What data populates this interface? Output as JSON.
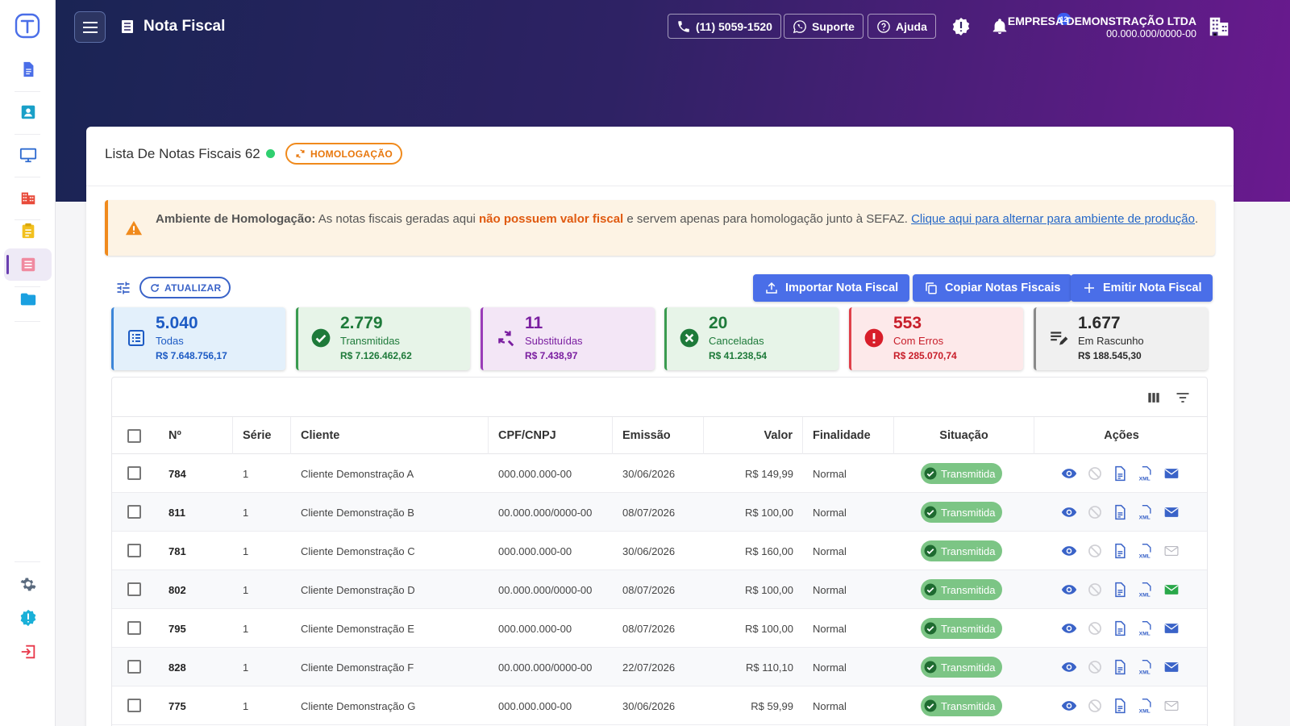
{
  "header": {
    "title": "Nota Fiscal",
    "phone": "(11) 5059-1520",
    "support": "Suporte",
    "help": "Ajuda",
    "notifications": "12",
    "company_name": "EMPRESA DEMONSTRAÇÃO LTDA",
    "company_cnpj": "00.000.000/0000-00"
  },
  "card": {
    "title": "Lista De Notas Fiscais 62",
    "env_badge": "HOMOLOGAÇÃO"
  },
  "alert": {
    "label": "Ambiente de Homologação:",
    "text1": " As notas fiscais geradas aqui ",
    "emph": "não possuem valor fiscal",
    "text2": " e servem apenas para homologação junto à SEFAZ. ",
    "link": "Clique aqui para alternar para ambiente de produção",
    "end": "."
  },
  "toolbar": {
    "refresh": "ATUALIZAR",
    "import": "Importar Nota Fiscal",
    "copy": "Copiar Notas Fiscais",
    "emit": "Emitir Nota Fiscal"
  },
  "stats": [
    {
      "num": "5.040",
      "label": "Todas",
      "value": "R$ 7.648.756,17",
      "color": "#1d5bc4",
      "bg": "#e3f0fb",
      "border": "#3d86d8"
    },
    {
      "num": "2.779",
      "label": "Transmitidas",
      "value": "R$ 7.126.462,62",
      "color": "#1e7a3a",
      "bg": "#e7f4e8",
      "border": "#3a9b50"
    },
    {
      "num": "11",
      "label": "Substituídas",
      "value": "R$ 7.438,97",
      "color": "#7a1ea0",
      "bg": "#f3e6f6",
      "border": "#9a3cb8"
    },
    {
      "num": "20",
      "label": "Canceladas",
      "value": "R$ 41.238,54",
      "color": "#1e7a3a",
      "bg": "#e7f4e8",
      "border": "#3a9b50"
    },
    {
      "num": "553",
      "label": "Com Erros",
      "value": "R$ 285.070,74",
      "color": "#c81e2a",
      "bg": "#fde9ea",
      "border": "#e0404a"
    },
    {
      "num": "1.677",
      "label": "Em Rascunho",
      "value": "R$ 188.545,30",
      "color": "#2a2a2a",
      "bg": "#f0f0f0",
      "border": "#8a8a8a"
    }
  ],
  "table": {
    "columns": [
      "Nº",
      "Série",
      "Cliente",
      "CPF/CNPJ",
      "Emissão",
      "Valor",
      "Finalidade",
      "Situação",
      "Ações"
    ],
    "rows": [
      {
        "num": "784",
        "serie": "1",
        "cliente": "Cliente Demonstração A",
        "doc": "000.000.000-00",
        "emissao": "30/06/2026",
        "valor": "R$ 149,99",
        "finalidade": "Normal",
        "situacao": "Transmitida",
        "mail": "sent"
      },
      {
        "num": "811",
        "serie": "1",
        "cliente": "Cliente Demonstração B",
        "doc": "00.000.000/0000-00",
        "emissao": "08/07/2026",
        "valor": "R$ 100,00",
        "finalidade": "Normal",
        "situacao": "Transmitida",
        "mail": "sent"
      },
      {
        "num": "781",
        "serie": "1",
        "cliente": "Cliente Demonstração C",
        "doc": "000.000.000-00",
        "emissao": "30/06/2026",
        "valor": "R$ 160,00",
        "finalidade": "Normal",
        "situacao": "Transmitida",
        "mail": "none"
      },
      {
        "num": "802",
        "serie": "1",
        "cliente": "Cliente Demonstração D",
        "doc": "00.000.000/0000-00",
        "emissao": "08/07/2026",
        "valor": "R$ 100,00",
        "finalidade": "Normal",
        "situacao": "Transmitida",
        "mail": "ok"
      },
      {
        "num": "795",
        "serie": "1",
        "cliente": "Cliente Demonstração E",
        "doc": "000.000.000-00",
        "emissao": "08/07/2026",
        "valor": "R$ 100,00",
        "finalidade": "Normal",
        "situacao": "Transmitida",
        "mail": "sent"
      },
      {
        "num": "828",
        "serie": "1",
        "cliente": "Cliente Demonstração F",
        "doc": "00.000.000/0000-00",
        "emissao": "22/07/2026",
        "valor": "R$ 110,10",
        "finalidade": "Normal",
        "situacao": "Transmitida",
        "mail": "sent"
      },
      {
        "num": "775",
        "serie": "1",
        "cliente": "Cliente Demonstração G",
        "doc": "000.000.000-00",
        "emissao": "30/06/2026",
        "valor": "R$ 59,99",
        "finalidade": "Normal",
        "situacao": "Transmitida",
        "mail": "none"
      }
    ]
  }
}
